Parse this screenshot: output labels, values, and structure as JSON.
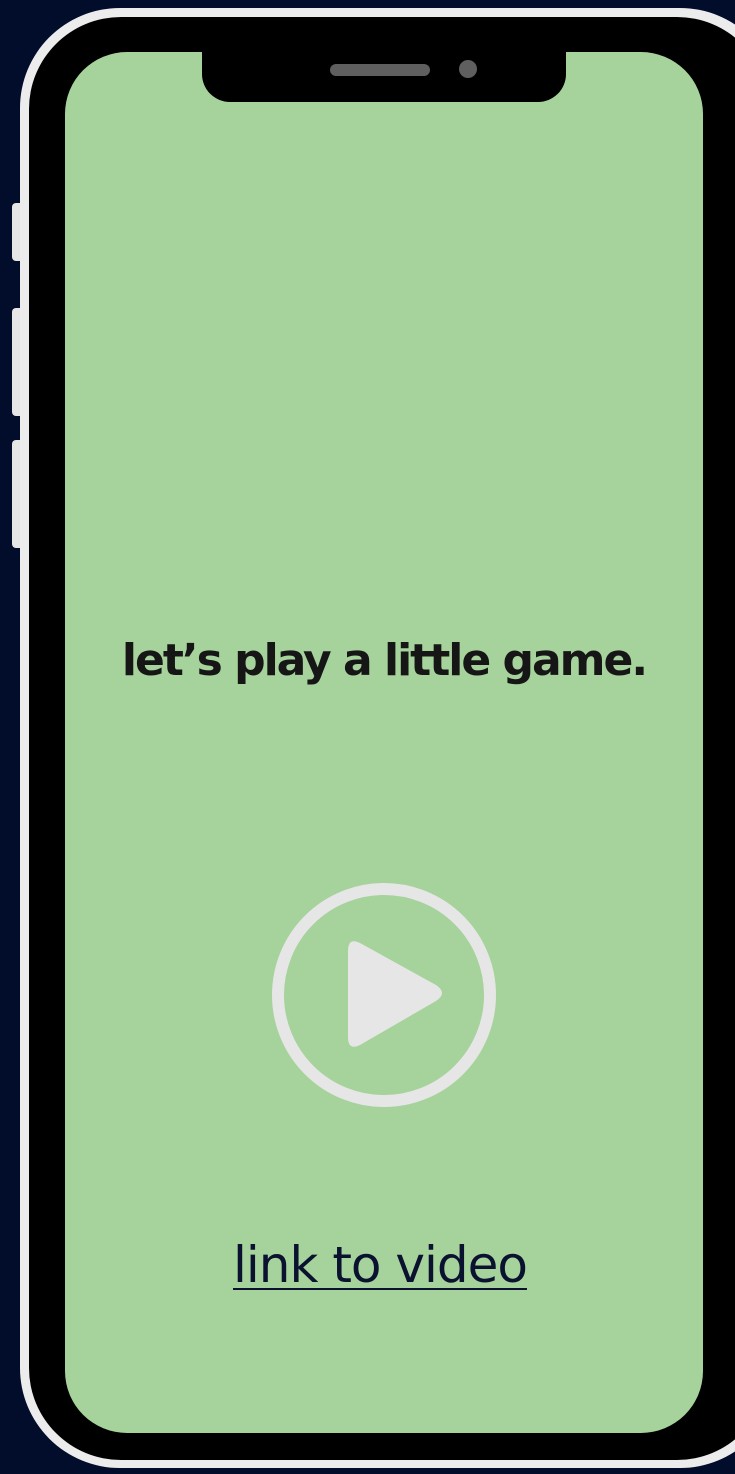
{
  "screen": {
    "headline": "let’s play a little game.",
    "play_button_icon": "play-circle-icon",
    "link_text": "link to video"
  },
  "colors": {
    "background": "#020d2b",
    "screen": "#a6d29b",
    "bezel": "#000000",
    "frame": "#ececec",
    "play_icon": "#e6e6e6",
    "headline_text": "#161616",
    "link_text": "#0a1230"
  }
}
